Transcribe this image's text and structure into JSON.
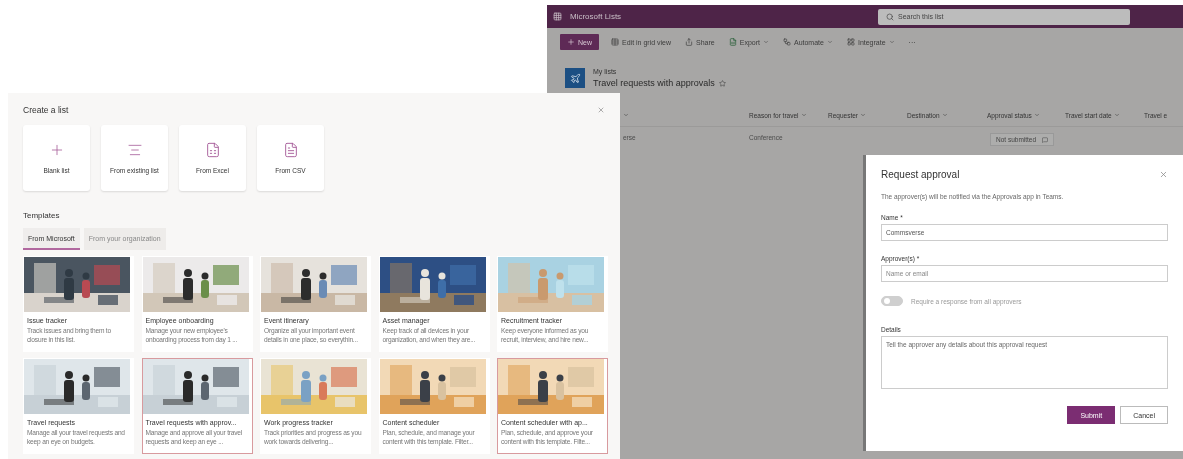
{
  "lists_app": {
    "app_name": "Microsoft Lists",
    "search": {
      "placeholder": "Search this list"
    },
    "toolbar": [
      {
        "kind": "new",
        "label": "New",
        "dropdown": false
      },
      {
        "kind": "grid",
        "label": "Edit in grid view",
        "dropdown": false
      },
      {
        "kind": "share",
        "label": "Share",
        "dropdown": false
      },
      {
        "kind": "export",
        "label": "Export",
        "dropdown": true
      },
      {
        "kind": "automate",
        "label": "Automate",
        "dropdown": true
      },
      {
        "kind": "integrate",
        "label": "Integrate",
        "dropdown": true
      },
      {
        "kind": "more",
        "label": "···",
        "dropdown": false
      }
    ],
    "breadcrumb": "My lists",
    "title": "Travel requests with approvals",
    "columns": [
      "Reason for travel",
      "Requester",
      "Destination",
      "Approval status",
      "Travel start date",
      "Travel e"
    ],
    "rows": [
      {
        "title": "erse",
        "reason": "Conference",
        "approval_status": "Not submitted"
      }
    ]
  },
  "dialog": {
    "title": "Request approval",
    "description": "The approver(s) will be notified via the Approvals app in Teams.",
    "fields": [
      {
        "kind": "text",
        "label": "Name *",
        "value": "Commsverse"
      },
      {
        "kind": "text",
        "label": "Approver(s) *",
        "placeholder": "Name or email"
      },
      {
        "kind": "toggle",
        "label": "Require a response from all approvers",
        "on": false,
        "disabled": true
      },
      {
        "kind": "textarea",
        "label": "Details",
        "placeholder": "Tell the approver any details about this approval request"
      }
    ],
    "buttons": [
      {
        "label": "Submit",
        "primary": true
      },
      {
        "label": "Cancel",
        "primary": false
      }
    ]
  },
  "create_list": {
    "title": "Create a list",
    "options": [
      {
        "kind": "blank",
        "label": "Blank list"
      },
      {
        "kind": "existing",
        "label": "From existing list"
      },
      {
        "kind": "excel",
        "label": "From Excel"
      },
      {
        "kind": "csv",
        "label": "From CSV"
      }
    ],
    "templates_heading": "Templates",
    "tabs": [
      {
        "label": "From Microsoft",
        "selected": true
      },
      {
        "label": "From your organization",
        "selected": false
      }
    ],
    "templates": [
      {
        "title": "Issue tracker",
        "description": "Track issues and bring them to closure in this list.",
        "selected": false
      },
      {
        "title": "Employee onboarding",
        "description": "Manage your new employee's onboarding process from day 1 ...",
        "selected": false
      },
      {
        "title": "Event itinerary",
        "description": "Organize all your important event details in one place, so everythin...",
        "selected": false
      },
      {
        "title": "Asset manager",
        "description": "Keep track of all devices in your organization, and when they are...",
        "selected": false
      },
      {
        "title": "Recruitment tracker",
        "description": "Keep everyone informed as you recruit, interview, and hire new...",
        "selected": false
      },
      {
        "title": "Travel requests",
        "description": "Manage all your travel requests and keep an eye on budgets.",
        "selected": false
      },
      {
        "title": "Travel requests with approv...",
        "description": "Manage and approve all your travel requests and keep an eye ...",
        "selected": true
      },
      {
        "title": "Work progress tracker",
        "description": "Track priorities and progress as you work towards delivering...",
        "selected": false
      },
      {
        "title": "Content scheduler",
        "description": "Plan, schedule, and manage your content with this template. Filter...",
        "selected": false
      },
      {
        "title": "Content scheduler with ap...",
        "description": "Plan, schedule, and approve your content with this template. Filte...",
        "selected": true
      }
    ]
  }
}
